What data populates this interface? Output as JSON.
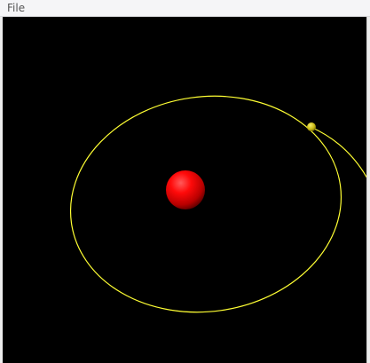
{
  "menubar": {
    "items": [
      {
        "label": "File"
      }
    ]
  },
  "scene": {
    "background": "#000000",
    "orbit_color": "#ffff33",
    "star_color": "#ff0000",
    "planet_color": "#d8c81a"
  }
}
